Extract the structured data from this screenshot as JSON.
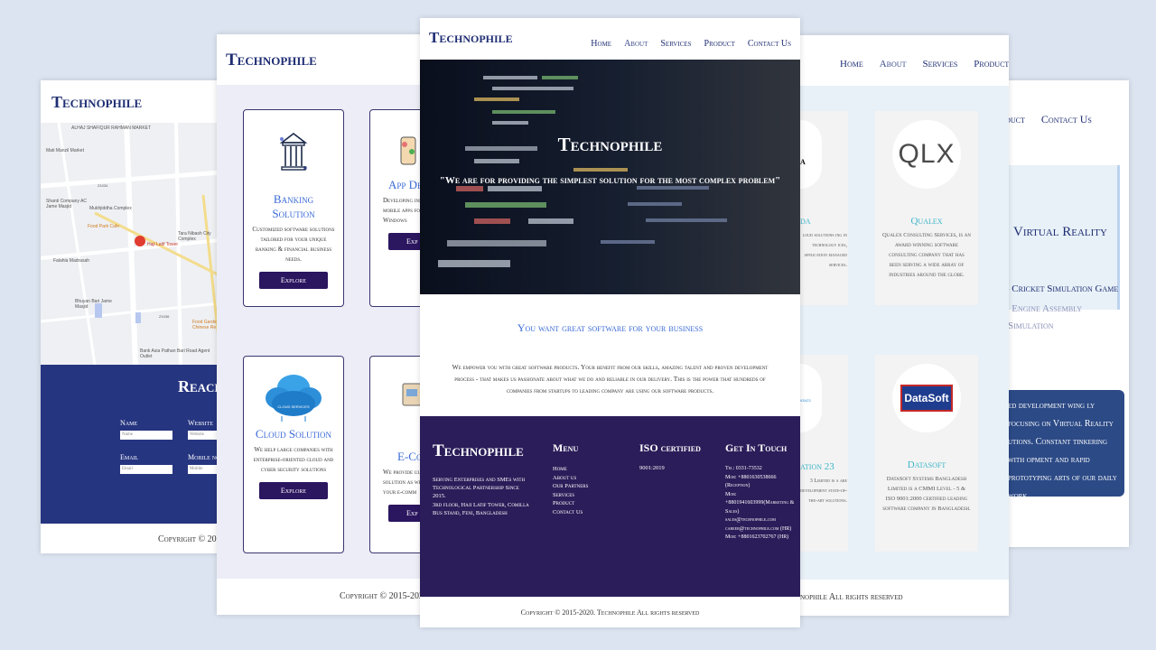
{
  "brand": "Technophile",
  "nav": [
    "Home",
    "About",
    "Services",
    "Product",
    "Contact Us"
  ],
  "map_page": {
    "map_labels": [
      "ALHAJ SHAFIQUR RAHMAN MARKET",
      "Mati Manzil Market",
      "Shanti Company AC Jame Masjid",
      "Mukhjiddha Complex",
      "Food Park Cafe",
      "Haji Latif Tower",
      "Tara Nibash City Complex",
      "Falahia Madrasah",
      "Bhuyan Bari Jame Masjid",
      "Bank Asia Pathan Bari Road Agent Outlet",
      "Food Garden Chinese Re",
      "Z1034",
      "Z1036"
    ],
    "reach": "Reach",
    "fields": [
      {
        "label": "Name",
        "placeholder": "Name"
      },
      {
        "label": "Website",
        "placeholder": "Website"
      },
      {
        "label": "Email",
        "placeholder": "Email"
      },
      {
        "label": "Mobile no",
        "placeholder": "Mobile"
      }
    ],
    "copyright": "Copyright © 2015-"
  },
  "services_page": {
    "cards": [
      {
        "title": "Banking Solution",
        "desc": "Customized software solutions tailored for your unique banking & financial business needs.",
        "button": "Explore"
      },
      {
        "title": "App Dev",
        "desc": "Developing inno mobile apps for A Windows",
        "button": "Exp"
      },
      {
        "title": "Cloud Solution",
        "desc": "We help large companies with enterprise-oriented cloud and cyber security solutions",
        "button": "Explore",
        "icon_text": "CLOUD SERVICES"
      },
      {
        "title": "E-Com",
        "desc": "We provide ulti solution as well as your e-comm",
        "button": "Exp"
      }
    ],
    "copyright": "Copyright © 2015-2020. Tec"
  },
  "main_page": {
    "hero_title": "Technophile",
    "hero_tagline": "\"We are for providing the simplest solution for the most complex problem\"",
    "subtitle": "You want great software for your business",
    "body": "We empower you with great software products. Your benefit from our skills, amazing talent and proven development process - that makes us passionate about what we do and reliable in our delivery. This is the power that hundreds of companies from startups to leading company are using our software products.",
    "footer": {
      "brand": "Technophile",
      "about": "Serving Enterprises and SMEs with Technological Partnership Since 2015.",
      "address": "3rd floor, Haji Latif Tower, Comilla Bus Stand, Feni, Bangladesh",
      "menu_title": "Menu",
      "menu": [
        "Home",
        "About us",
        "Our Partners",
        "Services",
        "Product",
        "Contact Us"
      ],
      "iso_title": "ISO certified",
      "iso": "9001:2019",
      "contact_title": "Get In Touch",
      "contact": [
        "Tel: 0331-73532",
        "Mob: +8801630538666 (Reception)",
        "Mob: +8801941603999(Marketing & Sales)",
        "sales@technophile.com",
        "career@technophile.com (HR)",
        "Mob: +8801623702767 (HR)"
      ]
    },
    "copyright": "Copyright © 2015-2020. Technophile All rights reserved"
  },
  "products_page": {
    "cards": [
      {
        "title": "da",
        "desc": "loud solutions ing in technology ices, application managed services."
      },
      {
        "title": "Qualex",
        "logo": "QLX",
        "desc": "Qualex Consulting Services, is an award winning software consulting company that has been serving a wide array of industries around the globe."
      },
      {
        "title": "ation 23",
        "logo": "ION23",
        "desc": "3 Limited is a are development state-of-the-art solutions."
      },
      {
        "title": "Datasoft",
        "logo": "DataSoft",
        "desc": "DataSoft Systems Bangladesh Limited is a CMMI Level - 5 & ISO 9001:2000 certified leading software company in Bangladesh."
      }
    ],
    "copyright": "nophile All rights reserved"
  },
  "vr_page": {
    "nav_partial": [
      "ices",
      "Product",
      "Contact Us"
    ],
    "title": "Virtual Reality",
    "items": [
      "Cricket Simulation Game",
      "Engine Assembly",
      "Simulation"
    ],
    "box": "ed development wing ly focusing on Virtual Reality utions. Constant tinkering with opment and rapid prototyping arts of our daily work."
  }
}
